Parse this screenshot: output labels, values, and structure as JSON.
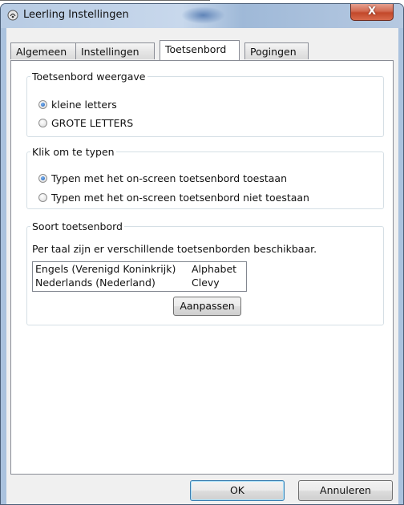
{
  "window": {
    "title": "Leerling Instellingen",
    "close_label": "X"
  },
  "tabs": [
    {
      "label": "Algemeen",
      "active": false
    },
    {
      "label": "Instellingen",
      "active": false
    },
    {
      "label": "Toetsenbord",
      "active": true
    },
    {
      "label": "Pogingen",
      "active": false
    }
  ],
  "keyboard_display": {
    "legend": "Toetsenbord weergave",
    "options": [
      {
        "label": "kleine letters",
        "checked": true
      },
      {
        "label": "GROTE  LETTERS",
        "checked": false
      }
    ]
  },
  "click_to_type": {
    "legend": "Klik om te typen",
    "options": [
      {
        "label": "Typen met het on-screen toetsenbord toestaan",
        "checked": true
      },
      {
        "label": "Typen met het on-screen toetsenbord niet toestaan",
        "checked": false
      }
    ]
  },
  "keyboard_type": {
    "legend": "Soort toetsenbord",
    "description": "Per taal zijn er verschillende toetsenborden beschikbaar.",
    "rows": [
      {
        "language": "Engels (Verenigd Koninkrijk)",
        "layout": "Alphabet"
      },
      {
        "language": "Nederlands (Nederland)",
        "layout": "Clevy"
      }
    ],
    "customize_label": "Aanpassen"
  },
  "footer": {
    "ok_label": "OK",
    "cancel_label": "Annuleren"
  },
  "colors": {
    "frame": "#aac2de",
    "close_button": "#c2482a",
    "radio_selected": "#1b59b5"
  }
}
